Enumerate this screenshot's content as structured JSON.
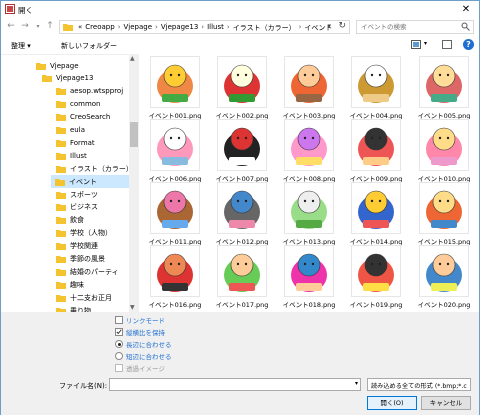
{
  "window": {
    "title": "開く"
  },
  "nav": {
    "breadcrumbs": [
      "«",
      "Creoapp",
      "Vjepage",
      "Vjepage13",
      "Illust",
      "イラスト（カラー）",
      "イベント"
    ],
    "search_placeholder": "イベントの検索"
  },
  "toolbar": {
    "organize": "整理 ▾",
    "new_folder": "新しいフォルダー",
    "help": "?"
  },
  "sidebar": {
    "items": [
      {
        "label": "Vjepage",
        "indent": 0
      },
      {
        "label": "Vjepage13",
        "indent": 1
      },
      {
        "label": "aesop.wtspproj",
        "indent": 2
      },
      {
        "label": "common",
        "indent": 2
      },
      {
        "label": "CreoSearch",
        "indent": 2
      },
      {
        "label": "eula",
        "indent": 2
      },
      {
        "label": "Format",
        "indent": 2
      },
      {
        "label": "Illust",
        "indent": 2
      },
      {
        "label": "イラスト（カラー）",
        "indent": 3
      },
      {
        "label": "イベント",
        "indent": 4,
        "selected": true
      },
      {
        "label": "スポーツ",
        "indent": 4
      },
      {
        "label": "ビジネス",
        "indent": 4
      },
      {
        "label": "飲食",
        "indent": 4
      },
      {
        "label": "学校（人物）",
        "indent": 4
      },
      {
        "label": "学校関連",
        "indent": 4
      },
      {
        "label": "季節の風景",
        "indent": 4
      },
      {
        "label": "結婚のパーティ",
        "indent": 4
      },
      {
        "label": "趣味",
        "indent": 4
      },
      {
        "label": "十二支お正月",
        "indent": 4
      },
      {
        "label": "乗り物",
        "indent": 4
      }
    ]
  },
  "files": [
    "イベント001.png",
    "イベント002.png",
    "イベント003.png",
    "イベント004.png",
    "イベント005.png",
    "イベント006.png",
    "イベント007.png",
    "イベント008.png",
    "イベント009.png",
    "イベント010.png",
    "イベント011.png",
    "イベント012.png",
    "イベント013.png",
    "イベント014.png",
    "イベント015.png",
    "イベント016.png",
    "イベント017.png",
    "イベント018.png",
    "イベント019.png",
    "イベント020.png"
  ],
  "options": {
    "link_mode": "リンクモード",
    "keep_ratio": "縦横比を保持",
    "fit_long": "長辺に合わせる",
    "fit_short": "短辺に合わせる",
    "transparent": "透過イメージ"
  },
  "footer": {
    "filename_label": "ファイル名(N):",
    "filename_value": "",
    "filter": "読み込める全ての形式 (*.bmp;*.c",
    "open": "開く(O)",
    "cancel": "キャンセル"
  },
  "colors": {
    "accent": "#1e6fcf",
    "selection": "#cce8ff",
    "folder": "#f4c430"
  }
}
